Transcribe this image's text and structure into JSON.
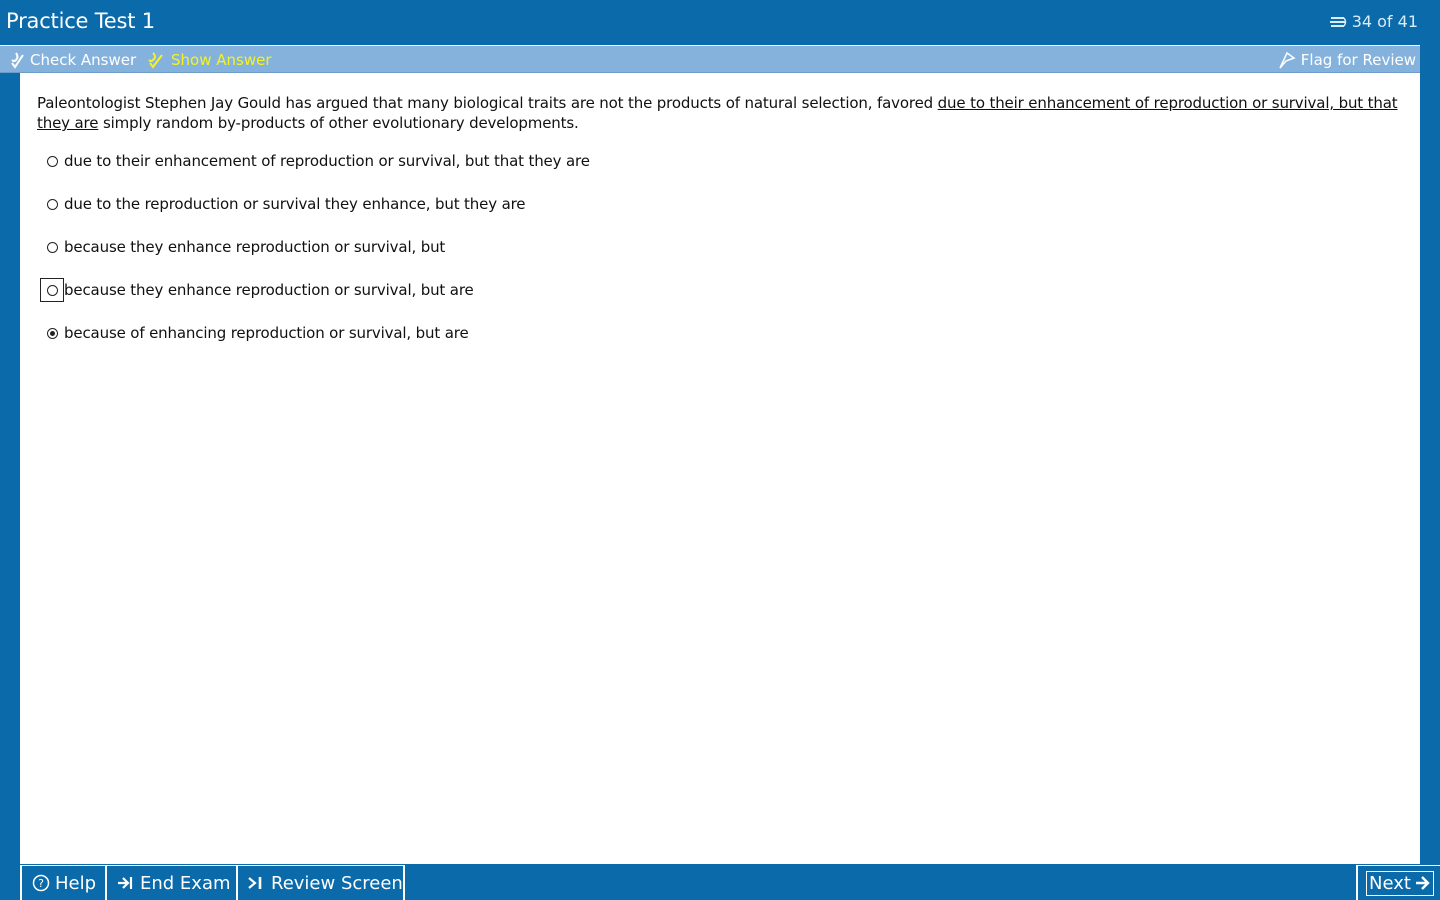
{
  "window": {
    "title": "Practice Test 1",
    "progress": "34 of 41"
  },
  "toolbar": {
    "check_answer": "Check Answer",
    "show_answer": "Show Answer",
    "flag_for_review": "Flag for Review"
  },
  "question": {
    "stem_before": "Paleontologist Stephen Jay Gould has argued that many biological traits are not the products of natural selection, favored ",
    "stem_underlined": "due to their enhancement of reproduction or survival, but that they are",
    "stem_after": " simply random by-products of other evolutionary developments.",
    "choices": [
      {
        "label": "due to their enhancement of reproduction or survival, but that they are"
      },
      {
        "label": "due to the reproduction or survival they enhance, but they are"
      },
      {
        "label": "because they enhance reproduction or survival, but"
      },
      {
        "label": "because they enhance reproduction or survival, but are"
      },
      {
        "label": "because of enhancing reproduction or survival, but are"
      }
    ],
    "selected_index": 4,
    "focused_index": 3
  },
  "bottombar": {
    "help": "Help",
    "end_exam": "End Exam",
    "review_screen": "Review Screen",
    "next": "Next"
  },
  "colors": {
    "frame_blue": "#0a6aaa",
    "toolbar_blue": "#84b2dc",
    "show_answer_yellow": "#f7f21f"
  }
}
